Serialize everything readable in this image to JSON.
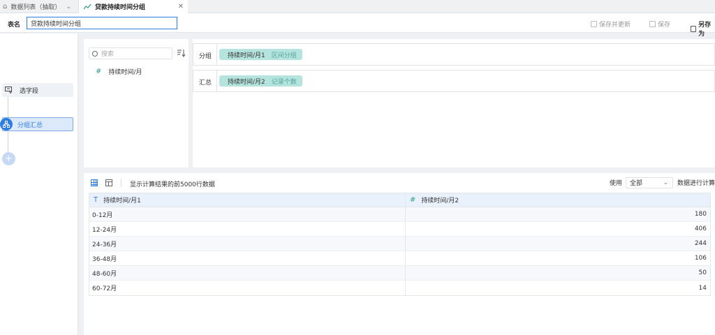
{
  "tabs": {
    "inactive_label": "数据列表（抽取）",
    "active_label": "贷款持续时间分组"
  },
  "namebar": {
    "label": "表名",
    "value": "贷款持续时间分组"
  },
  "toolbar": {
    "save_update": "保存并更新",
    "save": "保存",
    "save_as": "另存为"
  },
  "steps": [
    {
      "label": "选字段"
    },
    {
      "label": "分组汇总"
    }
  ],
  "fields": {
    "search_placeholder": "搜索",
    "items": [
      {
        "label": "持续时间/月"
      }
    ]
  },
  "zones": {
    "group": {
      "label": "分组",
      "pill": "持续时间/月1",
      "pill_sub": "区间分组"
    },
    "summary": {
      "label": "汇总",
      "pill": "持续时间/月2",
      "pill_sub": "记录个数"
    }
  },
  "preview": {
    "note": "显示计算结果的前5000行数据",
    "use_label": "使用",
    "use_value": "全部",
    "use_suffix": "数据进行计算"
  },
  "table": {
    "headers": [
      "持续时间/月1",
      "持续时间/月2"
    ],
    "rows": [
      [
        "0-12月",
        "180"
      ],
      [
        "12-24月",
        "406"
      ],
      [
        "24-36月",
        "244"
      ],
      [
        "36-48月",
        "106"
      ],
      [
        "48-60月",
        "50"
      ],
      [
        "60-72月",
        "14"
      ]
    ]
  },
  "colors": {
    "accent": "#2f7de1",
    "pill": "#b5e3dd",
    "header_bg": "#e9f1fc"
  }
}
